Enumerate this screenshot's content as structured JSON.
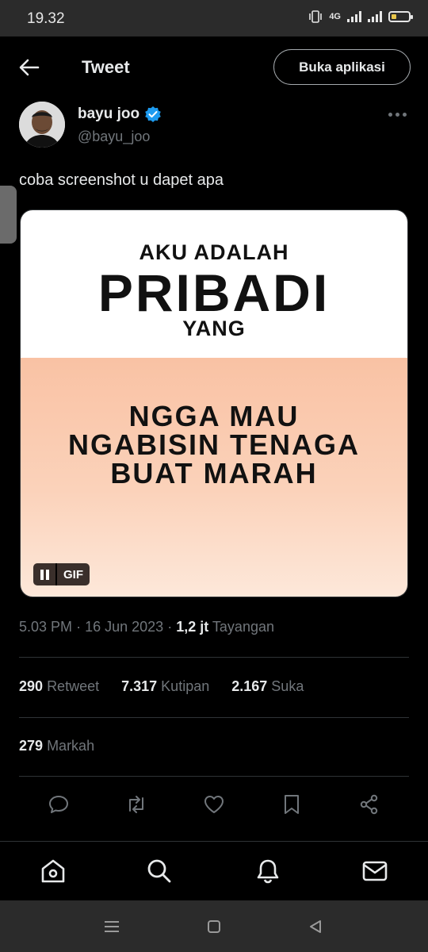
{
  "status_bar": {
    "time": "19.32",
    "network": "4G"
  },
  "header": {
    "title": "Tweet",
    "open_app_label": "Buka aplikasi"
  },
  "author": {
    "name": "bayu joo",
    "handle": "@bayu_joo",
    "verified": true
  },
  "tweet": {
    "text": "coba screenshot u dapet apa",
    "media": {
      "line1": "AKU ADALAH",
      "line2": "PRIBADI",
      "line3": "YANG",
      "body_lines": [
        "NGGA MAU",
        "NGABISIN TENAGA",
        "BUAT MARAH"
      ],
      "badge": "GIF"
    },
    "time": "5.03 PM",
    "date": "16 Jun 2023",
    "separator": "·",
    "views_count": "1,2 jt",
    "views_label": "Tayangan"
  },
  "stats": {
    "retweets_count": "290",
    "retweets_label": "Retweet",
    "quotes_count": "7.317",
    "quotes_label": "Kutipan",
    "likes_count": "2.167",
    "likes_label": "Suka",
    "bookmarks_count": "279",
    "bookmarks_label": "Markah"
  },
  "colors": {
    "background": "#000000",
    "accent": "#1d9bf0",
    "muted": "#71767b",
    "text": "#e7e9ea"
  }
}
